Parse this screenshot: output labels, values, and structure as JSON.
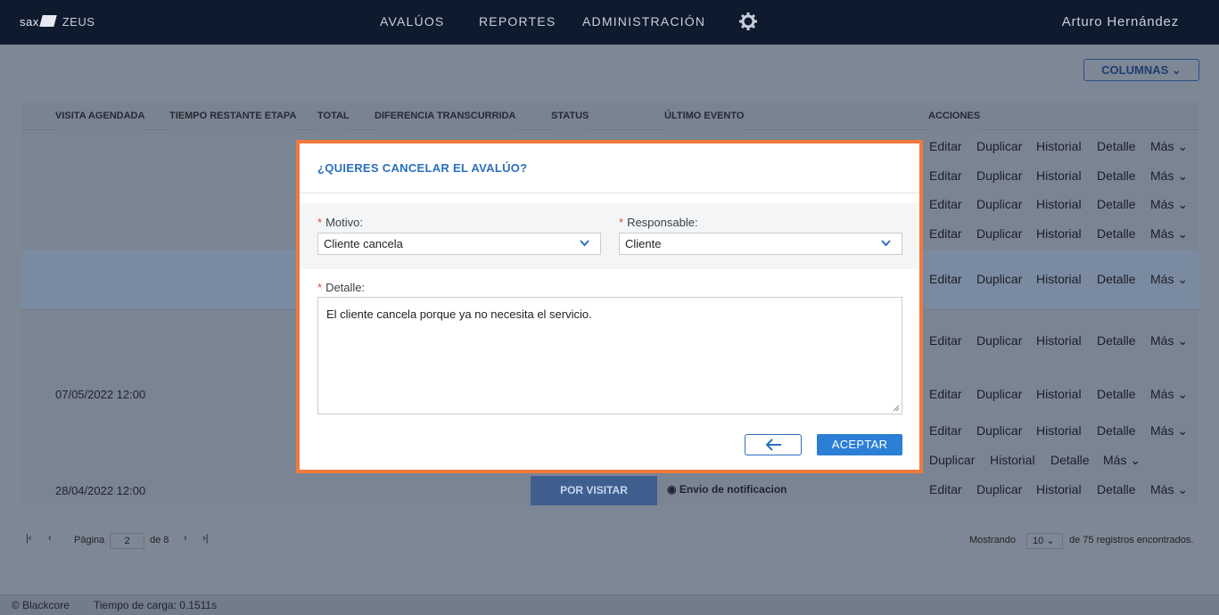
{
  "header": {
    "logo": "sax",
    "app": "ZEUS",
    "nav": [
      "AVALÚOS",
      "REPORTES",
      "ADMINISTRACIÓN"
    ],
    "user": "Arturo Hernández"
  },
  "toolbar": {
    "columns_label": "COLUMNAS"
  },
  "table": {
    "headers": [
      "VISITA AGENDADA",
      "TIEMPO RESTANTE ETAPA",
      "TOTAL",
      "DIFERENCIA TRANSCURRIDA",
      "STATUS",
      "ÚLTIMO EVENTO",
      "ACCIONES"
    ],
    "dates": {
      "r8": "07/05/2022 12:00",
      "r11": "28/04/2022 12:00"
    },
    "status_label": "POR VISITAR",
    "last_event": "Envio de notificacion",
    "actions": {
      "edit": "Editar",
      "dup": "Duplicar",
      "hist": "Historial",
      "detail": "Detalle",
      "more": "Más"
    }
  },
  "pager": {
    "page_label": "Página",
    "page": "2",
    "of_label": "de 8",
    "showing_label": "Mostrando",
    "per_page": "10",
    "records": "de 75 registros encontrados."
  },
  "footer": {
    "copyright": "© Blackcore",
    "load_time": "Tiempo de carga: 0.1511s"
  },
  "modal": {
    "title": "¿QUIERES CANCELAR EL AVALÚO?",
    "reason_label": "Motivo:",
    "reason_value": "Cliente cancela",
    "responsible_label": "Responsable:",
    "responsible_value": "Cliente",
    "detail_label": "Detalle:",
    "detail_value": "El cliente cancela porque ya no necesita el servicio.",
    "accept_label": "ACEPTAR"
  },
  "colors": {
    "accent": "#2b7fd6",
    "modal_border": "#ee7a3c",
    "navbar": "#0e1b2e"
  }
}
